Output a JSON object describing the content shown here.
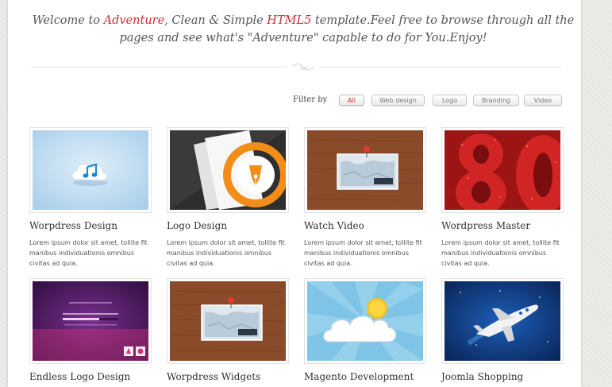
{
  "welcome": {
    "part1": "Welcome to ",
    "brand": "Adventure",
    "part2": ", Clean & Simple ",
    "html5": "HTML5",
    "part3": " template.Feel free to browse through all the pages and see what's \"Adventure\" capable to do for You.Enjoy!"
  },
  "filter": {
    "label": "Filter by",
    "buttons": [
      "All",
      "Web design",
      "Logo",
      "Branding",
      "Video"
    ],
    "active": "All"
  },
  "colors": {
    "accent": "#d12b31",
    "text": "#333333"
  },
  "portfolio": [
    {
      "title": "Worpdress Design",
      "description": "Lorem ipsum dolor sit amet, tollite fit manibus individuationis omnibus civitas ad quia.",
      "icon": "itunes-cloud-icon"
    },
    {
      "title": "Logo Design",
      "description": "Lorem ipsum dolor sit amet, tollite fit manibus individuationis omnibus civitas ad quia.",
      "icon": "pen-nib-icon"
    },
    {
      "title": "Watch Video",
      "description": "Lorem ipsum dolor sit amet, tollite fit manibus individuationis omnibus civitas ad quia.",
      "icon": "map-pin-icon"
    },
    {
      "title": "Wordpress Master",
      "description": "Lorem ipsum dolor sit amet, tollite fit manibus individuationis omnibus civitas ad quia.",
      "icon": "red-numbers-image"
    },
    {
      "title": "Endless Logo Design",
      "description": "",
      "icon": "purple-loading-image"
    },
    {
      "title": "Worpdress Widgets",
      "description": "",
      "icon": "map-pin-icon"
    },
    {
      "title": "Magento Development",
      "description": "",
      "icon": "sun-cloud-icon"
    },
    {
      "title": "Joomla Shopping",
      "description": "",
      "icon": "airplane-icon"
    }
  ]
}
